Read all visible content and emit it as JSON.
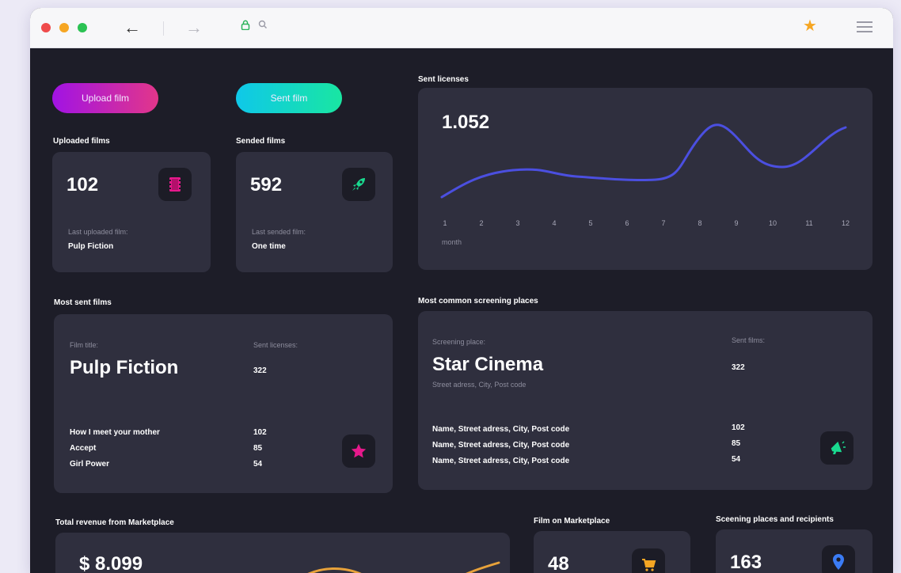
{
  "browser": {
    "back_icon": "arrow-left-icon",
    "forward_icon": "arrow-right-icon",
    "lock_icon": "lock-icon",
    "search_icon": "search-icon",
    "bookmark_icon": "star-icon",
    "menu_icon": "hamburger-icon"
  },
  "actions": {
    "upload_label": "Upload film",
    "sent_label": "Sent film"
  },
  "uploaded": {
    "title": "Uploaded films",
    "count": "102",
    "last_label": "Last uploaded film:",
    "last_value": "Pulp Fiction",
    "icon": "film-icon",
    "icon_color": "#e6198c"
  },
  "sended": {
    "title": "Sended films",
    "count": "592",
    "last_label": "Last sended film:",
    "last_value": "One time",
    "icon": "rocket-icon",
    "icon_color": "#19d98f"
  },
  "licenses": {
    "title": "Sent licenses",
    "total": "1.052",
    "x_ticks": [
      "1",
      "2",
      "3",
      "4",
      "5",
      "6",
      "7",
      "8",
      "9",
      "10",
      "11",
      "12"
    ],
    "x_label": "month",
    "line_color": "#4b4fe0"
  },
  "most_sent": {
    "title": "Most sent films",
    "film_label": "Film title:",
    "count_label": "Sent licenses:",
    "top_film": "Pulp Fiction",
    "top_count": "322",
    "rows": [
      {
        "name": "How I meet your mother",
        "count": "102"
      },
      {
        "name": "Accept",
        "count": "85"
      },
      {
        "name": "Girl Power",
        "count": "54"
      }
    ],
    "icon": "star-icon",
    "icon_color": "#e6198c"
  },
  "screening": {
    "title": "Most common screening places",
    "place_label": "Screening place:",
    "count_label": "Sent films:",
    "top_place": "Star Cinema",
    "top_address": "Street adress, City, Post code",
    "top_count": "322",
    "rows": [
      {
        "name": "Name, Street adress, City, Post code",
        "count": "102"
      },
      {
        "name": "Name, Street adress, City, Post code",
        "count": "85"
      },
      {
        "name": "Name, Street adress, City, Post code",
        "count": "54"
      }
    ],
    "icon": "megaphone-icon",
    "icon_color": "#19d98f"
  },
  "revenue": {
    "title": "Total revenue from Marketplace",
    "amount": "$ 8.099",
    "line_color": "#e8a23a"
  },
  "marketplace": {
    "title": "Film on Marketplace",
    "count": "48",
    "icon": "cart-icon",
    "icon_color": "#f6a623"
  },
  "recipients": {
    "title": "Sceening places and recipients",
    "count": "163",
    "icon": "map-pin-icon",
    "icon_color": "#3b7cf5"
  }
}
